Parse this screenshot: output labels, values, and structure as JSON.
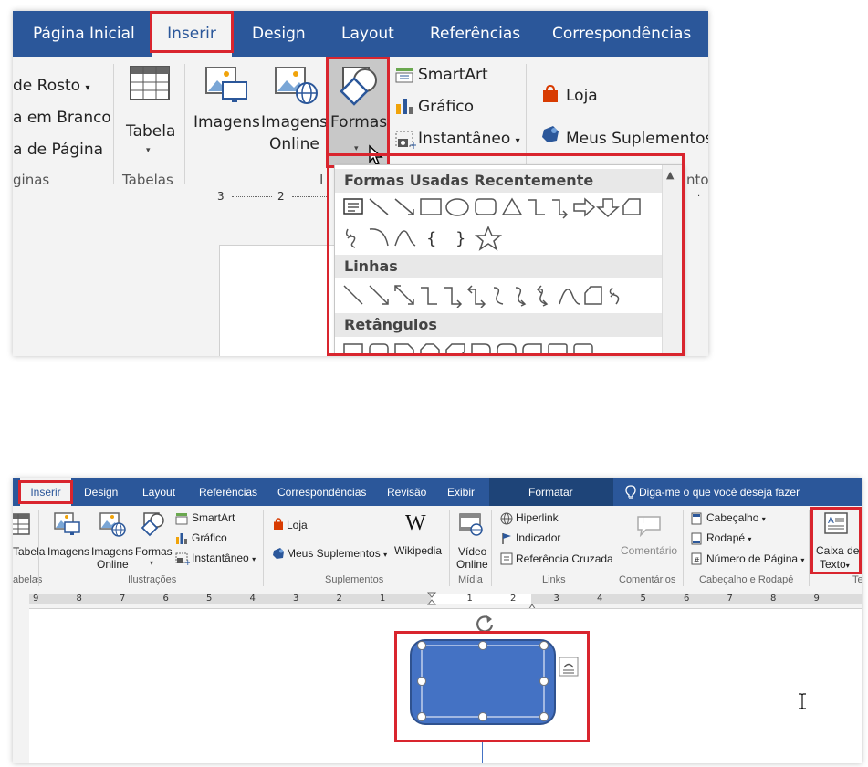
{
  "top": {
    "tabs": [
      {
        "label": "Página Inicial"
      },
      {
        "label": "Inserir"
      },
      {
        "label": "Design"
      },
      {
        "label": "Layout"
      },
      {
        "label": "Referências"
      },
      {
        "label": "Correspondências"
      }
    ],
    "pages": {
      "capa_label": "de Rosto",
      "branco_label": "a em Branco",
      "quebra_label": "a de Página",
      "group_label": "ginas"
    },
    "tabelas": {
      "button_label": "Tabela",
      "group_label": "Tabelas"
    },
    "ilustracoes": {
      "imagens_label": "Imagens",
      "imagens_online_label1": "Imagens",
      "imagens_online_label2": "Online",
      "formas_label": "Formas",
      "smartart_label": "SmartArt",
      "grafico_label": "Gráfico",
      "instantaneo_label": "Instantâneo",
      "group_label": "I"
    },
    "suplementos": {
      "loja_label": "Loja",
      "meus_label": "Meus Suplementos",
      "group_label": "nto"
    },
    "formas_panel": {
      "recent_header": "Formas Usadas Recentemente",
      "linhas_header": "Linhas",
      "retangulos_header": "Retângulos"
    },
    "ruler_numbers": [
      "3",
      "2"
    ]
  },
  "bottom": {
    "tabs": [
      {
        "label": "Inserir"
      },
      {
        "label": "Design"
      },
      {
        "label": "Layout"
      },
      {
        "label": "Referências"
      },
      {
        "label": "Correspondências"
      },
      {
        "label": "Revisão"
      },
      {
        "label": "Exibir"
      },
      {
        "label": "Formatar"
      }
    ],
    "tell_me": "Diga-me o que você deseja fazer",
    "tabela": {
      "label": "Tabela",
      "group_label": "abelas"
    },
    "ilustracoes": {
      "imagens_label": "Imagens",
      "imagens_online_label1": "Imagens",
      "imagens_online_label2": "Online",
      "formas_label": "Formas",
      "smartart_label": "SmartArt",
      "grafico_label": "Gráfico",
      "instantaneo_label": "Instantâneo",
      "group_label": "Ilustrações"
    },
    "suplementos": {
      "loja_label": "Loja",
      "meus_label": "Meus Suplementos",
      "wikipedia_label": "Wikipedia",
      "group_label": "Suplementos"
    },
    "midia": {
      "video_label1": "Vídeo",
      "video_label2": "Online",
      "group_label": "Mídia"
    },
    "links": {
      "hiperlink_label": "Hiperlink",
      "indicador_label": "Indicador",
      "ref_cruzada_label": "Referência Cruzada",
      "group_label": "Links"
    },
    "comentarios": {
      "comentario_label": "Comentário",
      "group_label": "Comentários"
    },
    "cabecalho": {
      "cabecalho_label": "Cabeçalho",
      "rodape_label": "Rodapé",
      "numero_label": "Número de Página",
      "group_label": "Cabeçalho e Rodapé"
    },
    "texto": {
      "caixa_label1": "Caixa de",
      "caixa_label2": "Texto",
      "group_label": "Te"
    },
    "ruler_numbers": [
      "9",
      "8",
      "7",
      "6",
      "5",
      "4",
      "3",
      "2",
      "1",
      "1",
      "2",
      "3",
      "4",
      "5",
      "6",
      "7",
      "8",
      "9"
    ]
  },
  "colors": {
    "tab_bar": "#2b579a",
    "highlight_red": "#d9252e",
    "shape_fill": "#4472c4",
    "shape_border": "#2f528f"
  }
}
